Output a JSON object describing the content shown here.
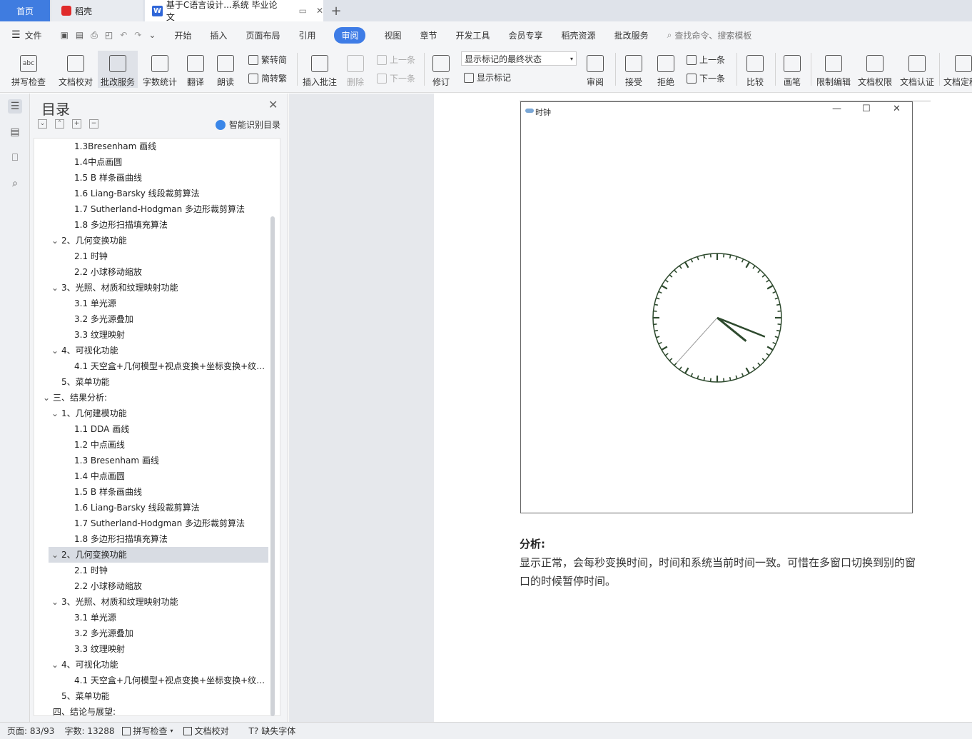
{
  "tabs": {
    "home": "首页",
    "daoke": "稻壳",
    "doc": "基于C语言设计...系统 毕业论文"
  },
  "menu": {
    "file": "文件",
    "items": [
      "开始",
      "插入",
      "页面布局",
      "引用",
      "审阅",
      "视图",
      "章节",
      "开发工具",
      "会员专享",
      "稻壳资源",
      "批改服务"
    ],
    "active": "审阅",
    "search_placeholder": "查找命令、搜索模板"
  },
  "ribbon": {
    "spell": "拼写检查",
    "proof": "文档校对",
    "correct": "批改服务",
    "wordcount": "字数统计",
    "translate": "翻译",
    "read": "朗读",
    "trad": "繁转简",
    "simp": "简转繁",
    "insert_comment": "插入批注",
    "delete": "删除",
    "prev": "上一条",
    "next": "下一条",
    "revise": "修订",
    "markup_state": "显示标记的最终状态",
    "show_markup": "显示标记",
    "review": "审阅",
    "accept": "接受",
    "reject": "拒绝",
    "prev2": "上一条",
    "next2": "下一条",
    "compare": "比较",
    "pen": "画笔",
    "restrict": "限制编辑",
    "permission": "文档权限",
    "certify": "文档认证",
    "finalize": "文档定稿"
  },
  "toc": {
    "title": "目录",
    "ai_label": "智能识别目录",
    "items": [
      {
        "text": "1.3Bresenham 画线",
        "level": 3,
        "chev": ""
      },
      {
        "text": "1.4中点画圆",
        "level": 3,
        "chev": ""
      },
      {
        "text": "1.5 B 样条画曲线",
        "level": 3,
        "chev": ""
      },
      {
        "text": "1.6 Liang-Barsky  线段裁剪算法",
        "level": 3,
        "chev": ""
      },
      {
        "text": "1.7 Sutherland-Hodgman 多边形裁剪算法",
        "level": 3,
        "chev": ""
      },
      {
        "text": "1.8  多边形扫描填充算法",
        "level": 3,
        "chev": ""
      },
      {
        "text": "2、几何变换功能",
        "level": 2,
        "chev": "v"
      },
      {
        "text": "2.1  时钟",
        "level": 3,
        "chev": ""
      },
      {
        "text": "2.2  小球移动缩放",
        "level": 3,
        "chev": ""
      },
      {
        "text": "3、光照、材质和纹理映射功能",
        "level": 2,
        "chev": "v"
      },
      {
        "text": "3.1  单光源",
        "level": 3,
        "chev": ""
      },
      {
        "text": "3.2  多光源叠加",
        "level": 3,
        "chev": ""
      },
      {
        "text": "3.3  纹理映射",
        "level": 3,
        "chev": ""
      },
      {
        "text": "4、可视化功能",
        "level": 2,
        "chev": "v"
      },
      {
        "text": "4.1  天空盒+几何模型+视点变换+坐标变换+纹…",
        "level": 3,
        "chev": ""
      },
      {
        "text": "5、菜单功能",
        "level": 2,
        "chev": ""
      },
      {
        "text": "三、结果分析:",
        "level": 1,
        "chev": "v"
      },
      {
        "text": "1、几何建模功能",
        "level": 2,
        "chev": "v"
      },
      {
        "text": "1.1 DDA 画线",
        "level": 3,
        "chev": ""
      },
      {
        "text": "1.2  中点画线",
        "level": 3,
        "chev": ""
      },
      {
        "text": "1.3 Bresenham 画线",
        "level": 3,
        "chev": ""
      },
      {
        "text": "1.4  中点画圆",
        "level": 3,
        "chev": ""
      },
      {
        "text": "1.5 B 样条画曲线",
        "level": 3,
        "chev": ""
      },
      {
        "text": "1.6 Liang-Barsky  线段裁剪算法",
        "level": 3,
        "chev": ""
      },
      {
        "text": "1.7 Sutherland-Hodgman 多边形裁剪算法",
        "level": 3,
        "chev": ""
      },
      {
        "text": "1.8  多边形扫描填充算法",
        "level": 3,
        "chev": ""
      },
      {
        "text": "2、几何变换功能",
        "level": 2,
        "chev": "v",
        "selected": true
      },
      {
        "text": "2.1  时钟",
        "level": 3,
        "chev": ""
      },
      {
        "text": "2.2  小球移动缩放",
        "level": 3,
        "chev": ""
      },
      {
        "text": "3、光照、材质和纹理映射功能",
        "level": 2,
        "chev": "v"
      },
      {
        "text": "3.1  单光源",
        "level": 3,
        "chev": ""
      },
      {
        "text": "3.2  多光源叠加",
        "level": 3,
        "chev": ""
      },
      {
        "text": "3.3  纹理映射",
        "level": 3,
        "chev": ""
      },
      {
        "text": "4、可视化功能",
        "level": 2,
        "chev": "v"
      },
      {
        "text": "4.1  天空盒+几何模型+视点变换+坐标变换+纹…",
        "level": 3,
        "chev": ""
      },
      {
        "text": "5、菜单功能",
        "level": 2,
        "chev": ""
      },
      {
        "text": "四、结论与展望:",
        "level": 1,
        "chev": ""
      }
    ]
  },
  "document": {
    "clock_window_title": "时钟",
    "clock_time": {
      "hour": 4,
      "minute": 18,
      "second": 37
    },
    "analysis_label": "分析:",
    "analysis_text": "显示正常，会每秒变换时间，时间和系统当前时间一致。可惜在多窗口切换到别的窗口的时候暂停时间。"
  },
  "status": {
    "page": "页面: 83/93",
    "words": "字数: 13288",
    "spell": "拼写检查",
    "proof": "文档校对",
    "missing_font": "缺失字体"
  },
  "colors": {
    "accent": "#3e7ce6",
    "clock": "#2e4a2e"
  }
}
